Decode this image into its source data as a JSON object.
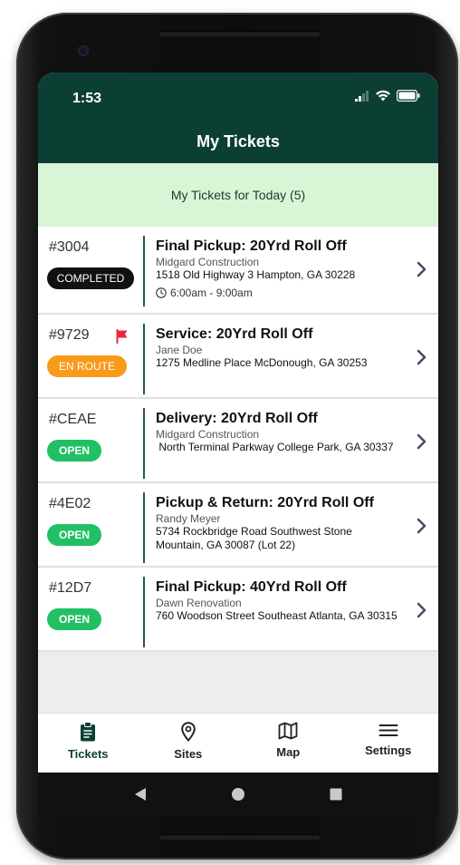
{
  "status_bar": {
    "time": "1:53"
  },
  "header": {
    "title": "My Tickets"
  },
  "banner": {
    "text": "My Tickets for Today (5)"
  },
  "tickets": [
    {
      "id": "#3004",
      "status": "COMPLETED",
      "job": "Final Pickup: 20Yrd Roll Off",
      "customer": "Midgard Construction",
      "address": "1518 Old Highway 3 Hampton, GA 30228",
      "time": "6:00am - 9:00am",
      "flagged": false
    },
    {
      "id": "#9729",
      "status": "EN ROUTE",
      "job": "Service: 20Yrd Roll Off",
      "customer": "Jane Doe",
      "address": "1275 Medline Place McDonough, GA 30253",
      "flagged": true
    },
    {
      "id": "#CEAE",
      "status": "OPEN",
      "job": "Delivery: 20Yrd Roll Off",
      "customer": "Midgard Construction",
      "address": " North Terminal Parkway College Park, GA 30337",
      "flagged": false
    },
    {
      "id": "#4E02",
      "status": "OPEN",
      "job": "Pickup & Return: 20Yrd Roll Off",
      "customer": "Randy Meyer",
      "address": "5734 Rockbridge Road Southwest Stone Mountain, GA 30087 (Lot 22)",
      "flagged": false
    },
    {
      "id": "#12D7",
      "status": "OPEN",
      "job": "Final Pickup: 40Yrd Roll Off",
      "customer": "Dawn Renovation",
      "address": "760 Woodson Street Southeast Atlanta, GA 30315",
      "flagged": false
    }
  ],
  "tabs": [
    {
      "label": "Tickets",
      "icon": "clipboard-icon",
      "active": true
    },
    {
      "label": "Sites",
      "icon": "map-pin-icon",
      "active": false
    },
    {
      "label": "Map",
      "icon": "map-icon",
      "active": false
    },
    {
      "label": "Settings",
      "icon": "menu-icon",
      "active": false
    }
  ],
  "colors": {
    "header": "#0c3f33",
    "banner": "#d8f5d6",
    "completed": "#111111",
    "en_route": "#f89b1a",
    "open": "#22c064",
    "flag": "#e8283a"
  }
}
